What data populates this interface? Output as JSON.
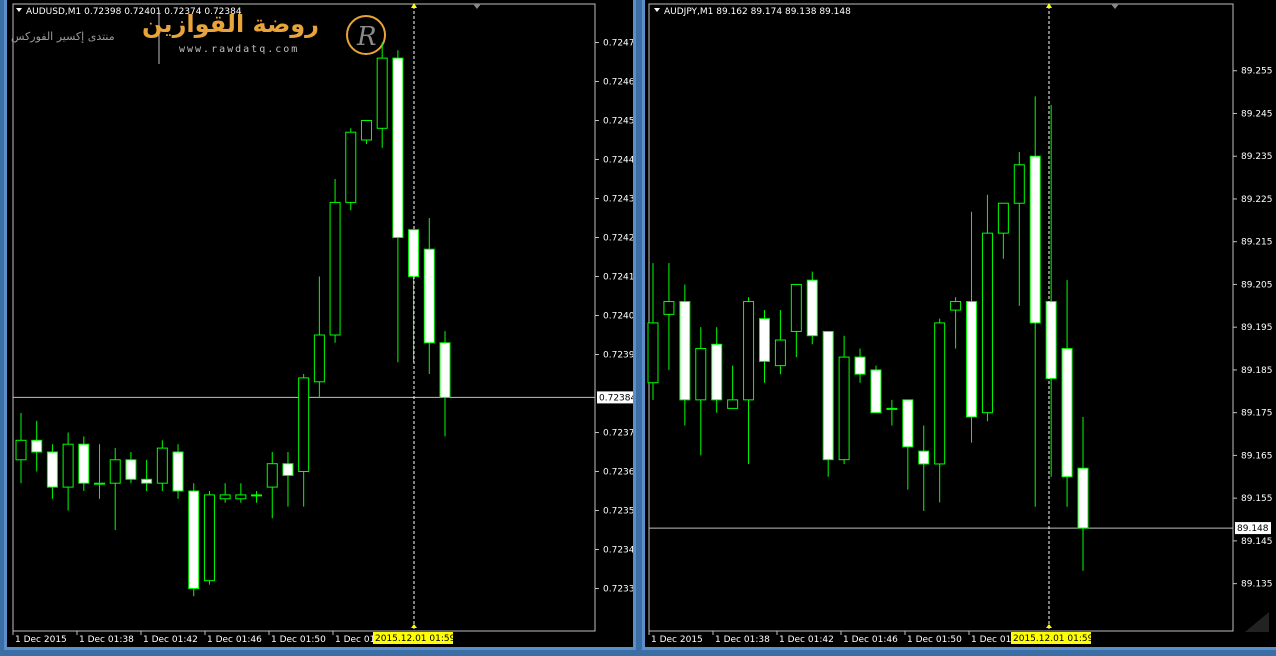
{
  "left_chart": {
    "header": "AUDUSD,M1  0.72398 0.72401 0.72374 0.72384",
    "current_price": "0.72384",
    "y_ticks": [
      "0.72475",
      "0.72465",
      "0.72455",
      "0.72445",
      "0.72435",
      "0.72425",
      "0.72415",
      "0.72405",
      "0.72395",
      "0.72384",
      "0.72375",
      "0.72365",
      "0.72355",
      "0.72345",
      "0.72335"
    ],
    "x_ticks": [
      "1 Dec 2015",
      "1 Dec 01:38",
      "1 Dec 01:42",
      "1 Dec 01:46",
      "1 Dec 01:50",
      "1 Dec 01:54"
    ],
    "crosshair_label": "2015.12.01 01:59",
    "watermark": {
      "title": "روضة القوازين",
      "url": "www.rawdatq.com",
      "subtitle": "منتدى إكسير الفوركس",
      "logo_letter": "R"
    }
  },
  "right_chart": {
    "header": "AUDJPY,M1  89.162 89.174 89.138 89.148",
    "current_price": "89.148",
    "y_ticks": [
      "89.255",
      "89.245",
      "89.235",
      "89.225",
      "89.215",
      "89.205",
      "89.195",
      "89.185",
      "89.175",
      "89.165",
      "89.155",
      "89.148",
      "89.145",
      "89.135"
    ],
    "x_ticks": [
      "1 Dec 2015",
      "1 Dec 01:38",
      "1 Dec 01:42",
      "1 Dec 01:46",
      "1 Dec 01:50",
      "1 Dec 01:54"
    ],
    "crosshair_label": "2015.12.01 01:59"
  },
  "colors": {
    "background": "#000000",
    "bull_body": "#000000",
    "bear_body": "#ffffff",
    "wick": "#00ff00",
    "crosshair_label_bg": "#ffff00",
    "price_line": "#c0c0c0"
  },
  "chart_data": [
    {
      "type": "candlestick",
      "symbol": "AUDUSD",
      "timeframe": "M1",
      "ylim": [
        0.7233,
        0.7248
      ],
      "candles": [
        {
          "o": 0.72368,
          "h": 0.7238,
          "l": 0.72362,
          "c": 0.72373
        },
        {
          "o": 0.72373,
          "h": 0.72378,
          "l": 0.72365,
          "c": 0.7237
        },
        {
          "o": 0.7237,
          "h": 0.72372,
          "l": 0.72358,
          "c": 0.72361
        },
        {
          "o": 0.72361,
          "h": 0.72375,
          "l": 0.72355,
          "c": 0.72372
        },
        {
          "o": 0.72372,
          "h": 0.72374,
          "l": 0.7236,
          "c": 0.72362
        },
        {
          "o": 0.72362,
          "h": 0.72372,
          "l": 0.72358,
          "c": 0.72362
        },
        {
          "o": 0.72362,
          "h": 0.72371,
          "l": 0.7235,
          "c": 0.72368
        },
        {
          "o": 0.72368,
          "h": 0.7237,
          "l": 0.72362,
          "c": 0.72363
        },
        {
          "o": 0.72363,
          "h": 0.72368,
          "l": 0.7236,
          "c": 0.72362
        },
        {
          "o": 0.72362,
          "h": 0.72373,
          "l": 0.7236,
          "c": 0.72371
        },
        {
          "o": 0.7237,
          "h": 0.72372,
          "l": 0.72358,
          "c": 0.7236
        },
        {
          "o": 0.7236,
          "h": 0.72362,
          "l": 0.72333,
          "c": 0.72335
        },
        {
          "o": 0.72337,
          "h": 0.7236,
          "l": 0.72336,
          "c": 0.72359
        },
        {
          "o": 0.72358,
          "h": 0.72362,
          "l": 0.72357,
          "c": 0.72359
        },
        {
          "o": 0.72358,
          "h": 0.72362,
          "l": 0.72357,
          "c": 0.72359
        },
        {
          "o": 0.72359,
          "h": 0.7236,
          "l": 0.72357,
          "c": 0.72359
        },
        {
          "o": 0.72361,
          "h": 0.7237,
          "l": 0.72353,
          "c": 0.72367
        },
        {
          "o": 0.72367,
          "h": 0.7237,
          "l": 0.72356,
          "c": 0.72364
        },
        {
          "o": 0.72365,
          "h": 0.7239,
          "l": 0.72356,
          "c": 0.72389
        },
        {
          "o": 0.72388,
          "h": 0.72415,
          "l": 0.72384,
          "c": 0.724
        },
        {
          "o": 0.724,
          "h": 0.7244,
          "l": 0.72398,
          "c": 0.72434
        },
        {
          "o": 0.72434,
          "h": 0.72453,
          "l": 0.72432,
          "c": 0.72452
        },
        {
          "o": 0.7245,
          "h": 0.72454,
          "l": 0.72449,
          "c": 0.72455
        },
        {
          "o": 0.72453,
          "h": 0.72475,
          "l": 0.72448,
          "c": 0.72471
        },
        {
          "o": 0.72471,
          "h": 0.72473,
          "l": 0.72393,
          "c": 0.72425
        },
        {
          "o": 0.72427,
          "h": 0.72427,
          "l": 0.72393,
          "c": 0.72415
        },
        {
          "o": 0.72422,
          "h": 0.7243,
          "l": 0.7239,
          "c": 0.72398
        },
        {
          "o": 0.72398,
          "h": 0.72401,
          "l": 0.72374,
          "c": 0.72384
        }
      ]
    },
    {
      "type": "candlestick",
      "symbol": "AUDJPY",
      "timeframe": "M1",
      "ylim": [
        89.13,
        89.265
      ],
      "candles": [
        {
          "o": 89.182,
          "h": 89.21,
          "l": 89.178,
          "c": 89.196
        },
        {
          "o": 89.198,
          "h": 89.21,
          "l": 89.185,
          "c": 89.201
        },
        {
          "o": 89.201,
          "h": 89.205,
          "l": 89.172,
          "c": 89.178
        },
        {
          "o": 89.178,
          "h": 89.195,
          "l": 89.165,
          "c": 89.19
        },
        {
          "o": 89.191,
          "h": 89.195,
          "l": 89.175,
          "c": 89.178
        },
        {
          "o": 89.176,
          "h": 89.186,
          "l": 89.176,
          "c": 89.178
        },
        {
          "o": 89.178,
          "h": 89.202,
          "l": 89.163,
          "c": 89.201
        },
        {
          "o": 89.197,
          "h": 89.199,
          "l": 89.182,
          "c": 89.187
        },
        {
          "o": 89.186,
          "h": 89.199,
          "l": 89.184,
          "c": 89.192
        },
        {
          "o": 89.194,
          "h": 89.205,
          "l": 89.188,
          "c": 89.205
        },
        {
          "o": 89.206,
          "h": 89.208,
          "l": 89.191,
          "c": 89.193
        },
        {
          "o": 89.194,
          "h": 89.194,
          "l": 89.16,
          "c": 89.164
        },
        {
          "o": 89.164,
          "h": 89.193,
          "l": 89.163,
          "c": 89.188
        },
        {
          "o": 89.188,
          "h": 89.19,
          "l": 89.182,
          "c": 89.184
        },
        {
          "o": 89.185,
          "h": 89.186,
          "l": 89.175,
          "c": 89.175
        },
        {
          "o": 89.176,
          "h": 89.178,
          "l": 89.172,
          "c": 89.176
        },
        {
          "o": 89.178,
          "h": 89.178,
          "l": 89.157,
          "c": 89.167
        },
        {
          "o": 89.166,
          "h": 89.172,
          "l": 89.152,
          "c": 89.163
        },
        {
          "o": 89.163,
          "h": 89.197,
          "l": 89.154,
          "c": 89.196
        },
        {
          "o": 89.199,
          "h": 89.202,
          "l": 89.19,
          "c": 89.201
        },
        {
          "o": 89.201,
          "h": 89.222,
          "l": 89.168,
          "c": 89.174
        },
        {
          "o": 89.175,
          "h": 89.226,
          "l": 89.173,
          "c": 89.217
        },
        {
          "o": 89.217,
          "h": 89.224,
          "l": 89.211,
          "c": 89.224
        },
        {
          "o": 89.224,
          "h": 89.236,
          "l": 89.2,
          "c": 89.233
        },
        {
          "o": 89.235,
          "h": 89.249,
          "l": 89.153,
          "c": 89.196
        },
        {
          "o": 89.201,
          "h": 89.247,
          "l": 89.16,
          "c": 89.183
        },
        {
          "o": 89.19,
          "h": 89.206,
          "l": 89.153,
          "c": 89.16
        },
        {
          "o": 89.162,
          "h": 89.174,
          "l": 89.138,
          "c": 89.148
        }
      ]
    }
  ]
}
